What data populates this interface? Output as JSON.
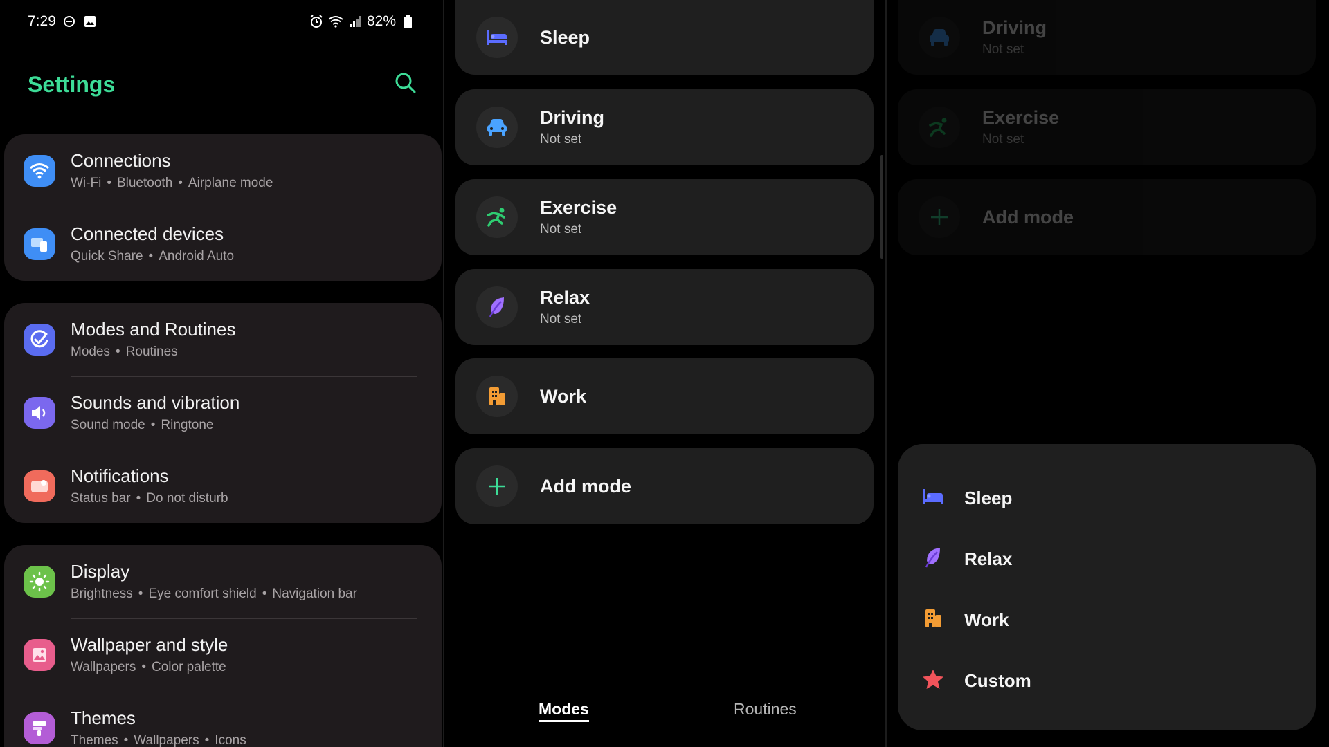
{
  "status_bar": {
    "time": "7:29",
    "battery": "82%"
  },
  "settings": {
    "title": "Settings",
    "groups": [
      [
        {
          "title": "Connections",
          "subtitle": [
            "Wi-Fi",
            "Bluetooth",
            "Airplane mode"
          ],
          "icon": "wifi-icon",
          "color": "#3f8ef5"
        },
        {
          "title": "Connected devices",
          "subtitle": [
            "Quick Share",
            "Android Auto"
          ],
          "icon": "devices-icon",
          "color": "#3f8ef5"
        }
      ],
      [
        {
          "title": "Modes and Routines",
          "subtitle": [
            "Modes",
            "Routines"
          ],
          "icon": "check-circle-icon",
          "color": "#5a6cf0"
        },
        {
          "title": "Sounds and vibration",
          "subtitle": [
            "Sound mode",
            "Ringtone"
          ],
          "icon": "speaker-icon",
          "color": "#7b68ee"
        },
        {
          "title": "Notifications",
          "subtitle": [
            "Status bar",
            "Do not disturb"
          ],
          "icon": "notification-icon",
          "color": "#f06b5c"
        }
      ],
      [
        {
          "title": "Display",
          "subtitle": [
            "Brightness",
            "Eye comfort shield",
            "Navigation bar"
          ],
          "icon": "sun-icon",
          "color": "#6cc24a"
        },
        {
          "title": "Wallpaper and style",
          "subtitle": [
            "Wallpapers",
            "Color palette"
          ],
          "icon": "image-icon",
          "color": "#e85d8c"
        },
        {
          "title": "Themes",
          "subtitle": [
            "Themes",
            "Wallpapers",
            "Icons"
          ],
          "icon": "theme-icon",
          "color": "#b35dd6"
        }
      ]
    ]
  },
  "modes": {
    "items": [
      {
        "title": "Sleep",
        "subtitle": "",
        "icon": "bed-icon",
        "color": "#5b6cff"
      },
      {
        "title": "Driving",
        "subtitle": "Not set",
        "icon": "car-icon",
        "color": "#4aa3ff"
      },
      {
        "title": "Exercise",
        "subtitle": "Not set",
        "icon": "running-icon",
        "color": "#2ecc71"
      },
      {
        "title": "Relax",
        "subtitle": "Not set",
        "icon": "leaf-icon",
        "color": "#a070ff"
      },
      {
        "title": "Work",
        "subtitle": "",
        "icon": "building-icon",
        "color": "#f39c34"
      },
      {
        "title": "Add mode",
        "subtitle": "",
        "icon": "plus-icon",
        "color": "#3ddc97"
      }
    ],
    "tabs": {
      "modes": "Modes",
      "routines": "Routines"
    }
  },
  "dimmed_modes": [
    {
      "title": "Driving",
      "subtitle": "Not set"
    },
    {
      "title": "Exercise",
      "subtitle": "Not set"
    },
    {
      "title": "Add mode"
    }
  ],
  "sheet": {
    "items": [
      {
        "label": "Sleep",
        "icon": "bed-icon"
      },
      {
        "label": "Relax",
        "icon": "leaf-icon"
      },
      {
        "label": "Work",
        "icon": "building-icon"
      },
      {
        "label": "Custom",
        "icon": "star-icon"
      }
    ]
  }
}
